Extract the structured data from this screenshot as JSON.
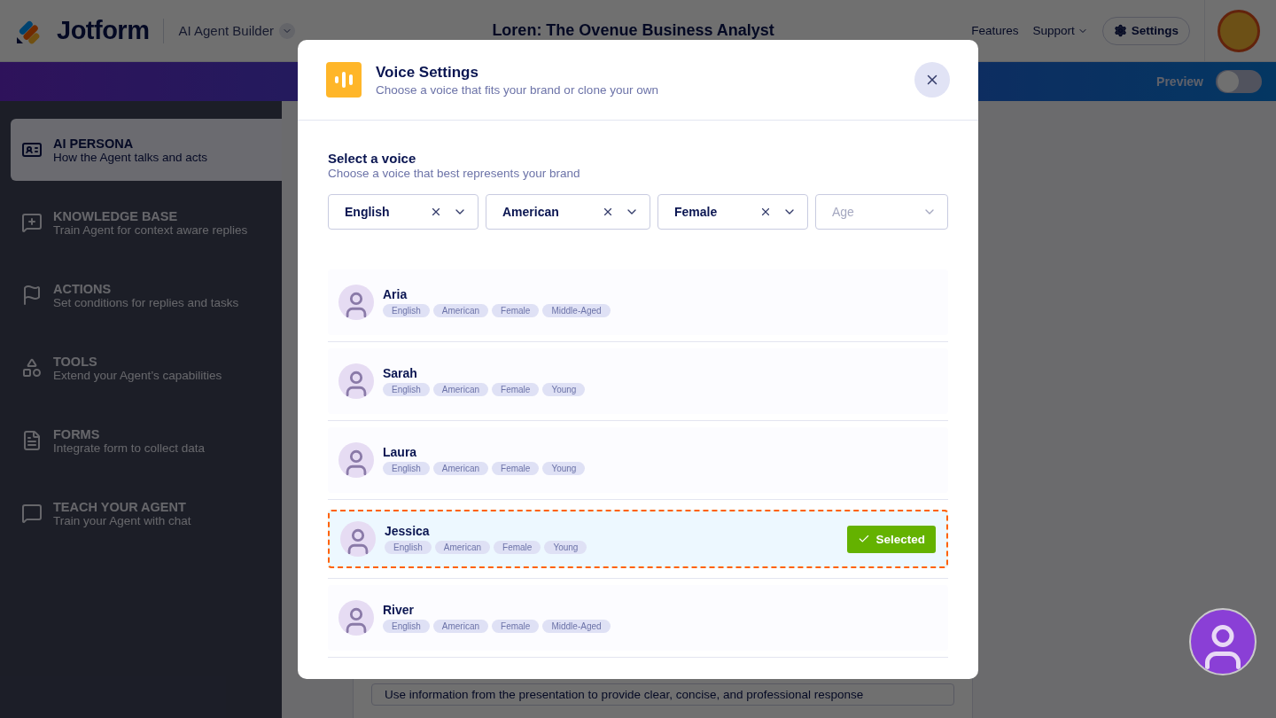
{
  "header": {
    "brand": "Jotform",
    "product": "AI Agent Builder",
    "title": "Loren: The Ovenue Business Analyst",
    "links": [
      {
        "label": "Features",
        "dropdown": false
      },
      {
        "label": "Support",
        "dropdown": true
      }
    ],
    "settings": "Settings"
  },
  "toolbar": {
    "preview_label": "Preview",
    "preview_on": false
  },
  "sidebar": {
    "items": [
      {
        "title": "AI PERSONA",
        "subtitle": "How the Agent talks and acts",
        "selected": true
      },
      {
        "title": "KNOWLEDGE BASE",
        "subtitle": "Train Agent for context aware replies",
        "selected": false
      },
      {
        "title": "ACTIONS",
        "subtitle": "Set conditions for replies and tasks",
        "selected": false
      },
      {
        "title": "TOOLS",
        "subtitle": "Extend your Agent’s capabilities",
        "selected": false
      },
      {
        "title": "FORMS",
        "subtitle": "Integrate form to collect data",
        "selected": false
      },
      {
        "title": "TEACH YOUR AGENT",
        "subtitle": "Train your Agent with chat",
        "selected": false
      }
    ]
  },
  "main": {
    "rules": [
      "Use information from the presentation to provide clear, concise, and professional response"
    ]
  },
  "modal": {
    "title": "Voice Settings",
    "subtitle": "Choose a voice that fits your brand or clone your own",
    "section_title": "Select a voice",
    "section_subtitle": "Choose a voice that best represents your brand",
    "filters": [
      {
        "value": "English"
      },
      {
        "value": "American"
      },
      {
        "value": "Female"
      },
      {
        "placeholder": "Age"
      }
    ],
    "voices": [
      {
        "name": "Aria",
        "tags": [
          "English",
          "American",
          "Female",
          "Middle-Aged"
        ],
        "selected": false
      },
      {
        "name": "Sarah",
        "tags": [
          "English",
          "American",
          "Female",
          "Young"
        ],
        "selected": false
      },
      {
        "name": "Laura",
        "tags": [
          "English",
          "American",
          "Female",
          "Young"
        ],
        "selected": false
      },
      {
        "name": "Jessica",
        "tags": [
          "English",
          "American",
          "Female",
          "Young"
        ],
        "selected": true
      },
      {
        "name": "River",
        "tags": [
          "English",
          "American",
          "Female",
          "Middle-Aged"
        ],
        "selected": false
      }
    ],
    "selected_label": "Selected"
  }
}
